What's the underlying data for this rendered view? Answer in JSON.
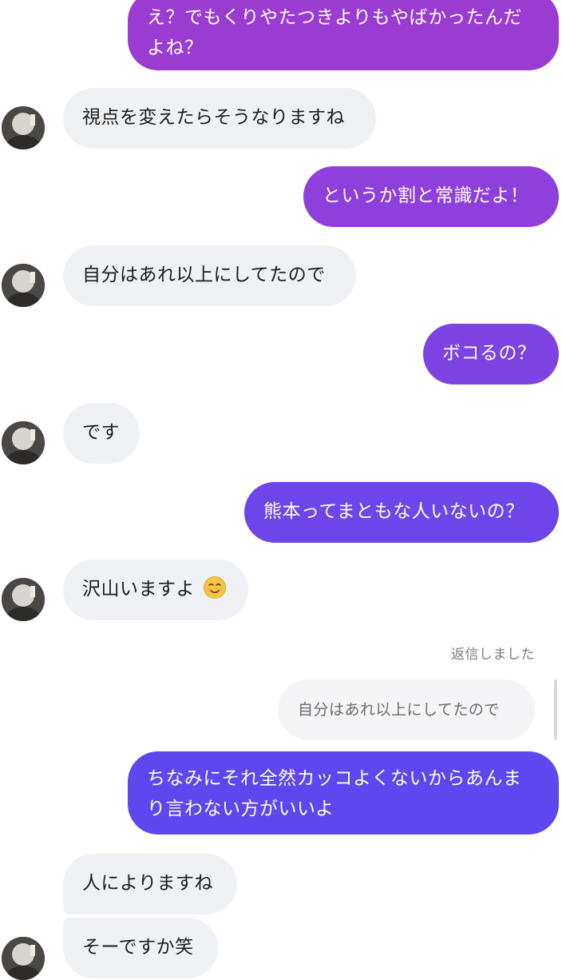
{
  "messages": {
    "m1": "え？でもくりやたつきよりもやばかったんだよね？",
    "m2": "視点を変えたらそうなりますね",
    "m3": "というか割と常識だよ！",
    "m4": "自分はあれ以上にしてたので",
    "m5": "ボコるの？",
    "m6": "です",
    "m7": "熊本ってまともな人いないの？",
    "m8": "沢山いますよ",
    "m9": "ちなみにそれ全然カッコよくないからあんまり言わない方がいいよ",
    "m10": "人によりますね",
    "m11": "そーですか笑"
  },
  "reply": {
    "label": "返信しました",
    "quoted": "自分はあれ以上にしてたので"
  },
  "emoji": {
    "m8": "smiling-face-icon"
  },
  "colors": {
    "sent_gradient_top": "#9b3bd0",
    "sent_gradient_bottom": "#5b47ee",
    "received_bubble": "#f0f1f4",
    "page_background": "#ffffff"
  }
}
